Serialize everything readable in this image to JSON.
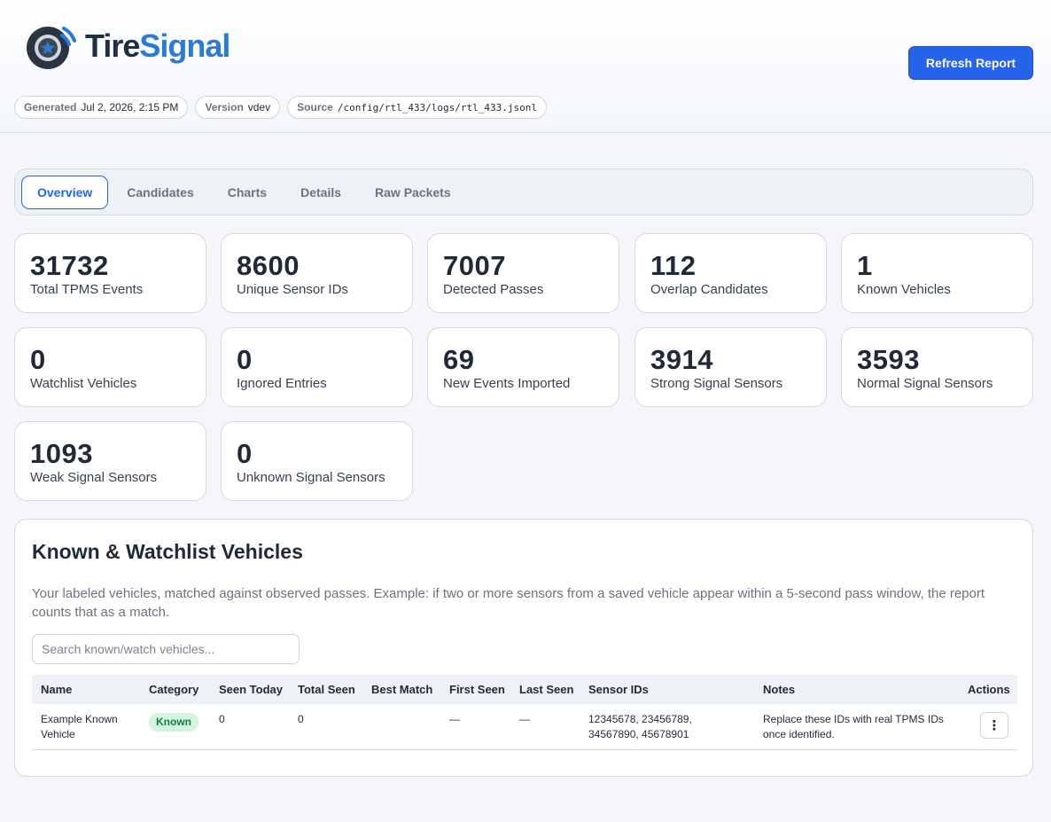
{
  "app": {
    "name_part1": "Tire",
    "name_part2": "Signal",
    "refresh_label": "Refresh Report"
  },
  "meta": [
    {
      "key": "Generated",
      "value": "Jul 2, 2026, 2:15 PM",
      "mono": false
    },
    {
      "key": "Version",
      "value": "vdev",
      "mono": false
    },
    {
      "key": "Source",
      "value": "/config/rtl_433/logs/rtl_433.jsonl",
      "mono": true
    }
  ],
  "tabs": [
    {
      "label": "Overview",
      "active": true
    },
    {
      "label": "Candidates",
      "active": false
    },
    {
      "label": "Charts",
      "active": false
    },
    {
      "label": "Details",
      "active": false
    },
    {
      "label": "Raw Packets",
      "active": false
    }
  ],
  "stats": [
    {
      "value": "31732",
      "label": "Total TPMS Events"
    },
    {
      "value": "8600",
      "label": "Unique Sensor IDs"
    },
    {
      "value": "7007",
      "label": "Detected Passes"
    },
    {
      "value": "112",
      "label": "Overlap Candidates"
    },
    {
      "value": "1",
      "label": "Known Vehicles"
    },
    {
      "value": "0",
      "label": "Watchlist Vehicles"
    },
    {
      "value": "0",
      "label": "Ignored Entries"
    },
    {
      "value": "69",
      "label": "New Events Imported"
    },
    {
      "value": "3914",
      "label": "Strong Signal Sensors"
    },
    {
      "value": "3593",
      "label": "Normal Signal Sensors"
    },
    {
      "value": "1093",
      "label": "Weak Signal Sensors"
    },
    {
      "value": "0",
      "label": "Unknown Signal Sensors"
    }
  ],
  "vehicles": {
    "title": "Known & Watchlist Vehicles",
    "description": "Your labeled vehicles, matched against observed passes. Example: if two or more sensors from a saved vehicle appear within a 5-second pass window, the report counts that as a match.",
    "search_placeholder": "Search known/watch vehicles...",
    "columns": [
      "Name",
      "Category",
      "Seen Today",
      "Total Seen",
      "Best Match",
      "First Seen",
      "Last Seen",
      "Sensor IDs",
      "Notes",
      "Actions"
    ],
    "rows": [
      {
        "name": "Example Known Vehicle",
        "category": "Known",
        "seen_today": "0",
        "total_seen": "0",
        "best_match": "",
        "first_seen": "—",
        "last_seen": "—",
        "sensor_ids": "12345678, 23456789, 34567890, 45678901",
        "notes": "Replace these IDs with real TPMS IDs once identified.",
        "actions_icon": "⋮"
      }
    ]
  },
  "colors": {
    "accent": "#2563eb",
    "logo_dark": "#1f2f44",
    "logo_blue": "#2a7bd8",
    "known_badge_bg": "#d1f5df",
    "known_badge_fg": "#15803d"
  }
}
